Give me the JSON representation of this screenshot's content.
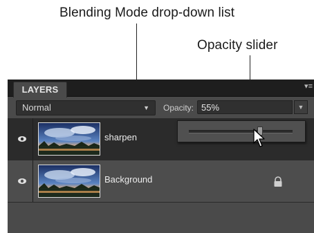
{
  "callouts": {
    "blend_label": "Blending Mode drop-down list",
    "opacity_label": "Opacity slider"
  },
  "panel": {
    "tab_label": "LAYERS",
    "menu_icon": "panel-menu-icon"
  },
  "toolbar": {
    "blend_mode_value": "Normal",
    "opacity_label": "Opacity:",
    "opacity_value": "55%"
  },
  "opacity_slider": {
    "level": 0.55
  },
  "layers": [
    {
      "name": "sharpen",
      "visible": true,
      "selected": true,
      "locked": false
    },
    {
      "name": "Background",
      "visible": true,
      "selected": false,
      "locked": true
    }
  ],
  "colors": {
    "panel_bg": "#4a4a4a",
    "tabbar_bg": "#1e1e1e",
    "selected_row": "#2b2b2b"
  }
}
